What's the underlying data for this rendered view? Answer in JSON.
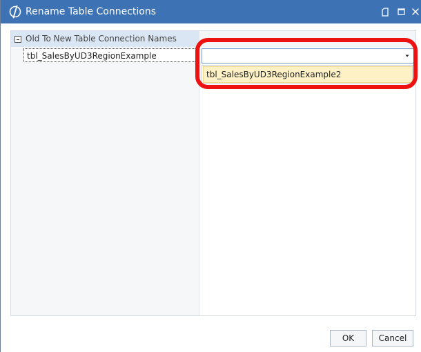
{
  "window": {
    "title": "Rename Table Connections",
    "controls": {
      "restore": "restore-icon",
      "maximize": "maximize-icon",
      "close": "close-icon"
    }
  },
  "property_grid": {
    "category_label": "Old To New Table Connection Names",
    "rows": [
      {
        "name": "tbl_SalesByUD3RegionExample",
        "value": ""
      }
    ],
    "dropdown": {
      "options": [
        "tbl_SalesByUD3RegionExample2"
      ],
      "highlighted_index": 0
    }
  },
  "buttons": {
    "ok": "OK",
    "cancel": "Cancel"
  },
  "colors": {
    "titlebar": "#3d73b5",
    "category_row": "#dbe6f4",
    "dropdown_highlight": "#fff1c6",
    "annotation_ring": "#ee1111"
  }
}
